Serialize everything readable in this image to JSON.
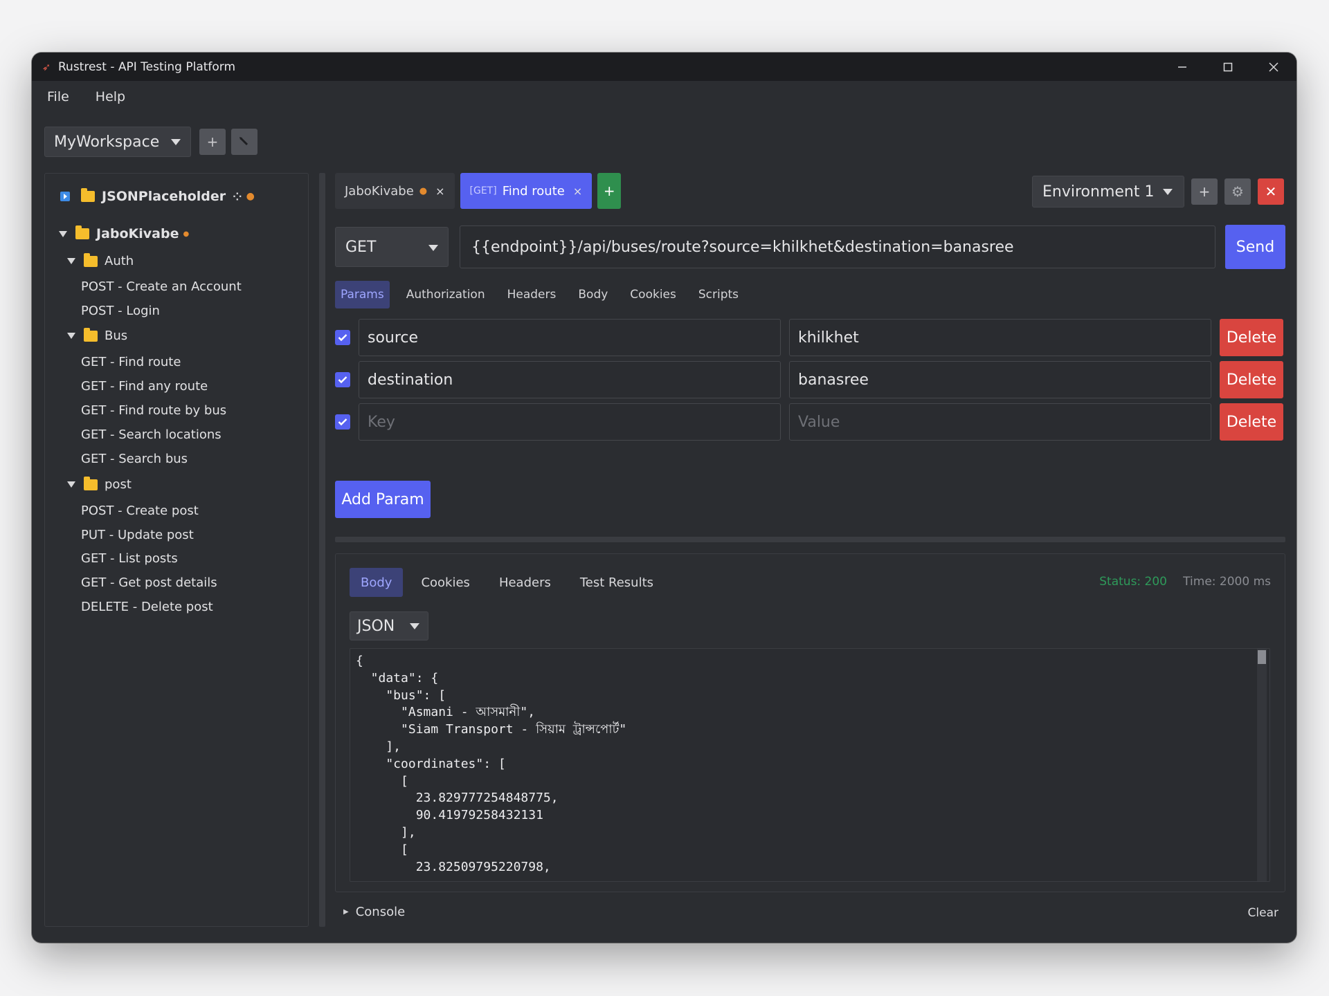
{
  "window": {
    "title": "Rustrest - API Testing Platform"
  },
  "menu": [
    "File",
    "Help"
  ],
  "workspace": {
    "selected": "MyWorkspace",
    "add_label": "+"
  },
  "sidebar": {
    "collection": "JSONPlaceholder",
    "project": "JaboKivabe",
    "folders": [
      {
        "name": "Auth",
        "items": [
          "POST - Create an Account",
          "POST - Login"
        ]
      },
      {
        "name": "Bus",
        "items": [
          "GET - Find route",
          "GET - Find any route",
          "GET - Find route by bus",
          "GET - Search locations",
          "GET - Search bus"
        ]
      },
      {
        "name": "post",
        "items": [
          "POST - Create post",
          "PUT - Update post",
          "GET - List posts",
          "GET - Get post details",
          "DELETE - Delete post"
        ]
      }
    ]
  },
  "tabs": [
    {
      "label": "JaboKivabe",
      "close": "×"
    },
    {
      "method": "[GET]",
      "label": "Find route",
      "close": "×"
    }
  ],
  "add_tab_label": "+",
  "environment": {
    "selected": "Environment 1",
    "add_label": "+",
    "delete_label": "✕"
  },
  "request": {
    "method": "GET",
    "url": "{{endpoint}}/api/buses/route?source=khilkhet&destination=banasree",
    "send_label": "Send"
  },
  "request_tabs": [
    "Params",
    "Authorization",
    "Headers",
    "Body",
    "Cookies",
    "Scripts"
  ],
  "params": [
    {
      "key": "source",
      "value": "khilkhet",
      "enabled": true
    },
    {
      "key": "destination",
      "value": "banasree",
      "enabled": true
    },
    {
      "key": "",
      "value": "",
      "enabled": true
    }
  ],
  "param_placeholders": {
    "key": "Key",
    "value": "Value"
  },
  "delete_label": "Delete",
  "add_param_label": "Add Param",
  "response": {
    "tabs": [
      "Body",
      "Cookies",
      "Headers",
      "Test Results"
    ],
    "status": "Status: 200",
    "time": "Time: 2000 ms",
    "format": "JSON",
    "body": "{\n  \"data\": {\n    \"bus\": [\n      \"Asmani - আসমানী\",\n      \"Siam Transport - সিয়াম ট্রান্সপোর্ট\"\n    ],\n    \"coordinates\": [\n      [\n        23.829777254848775,\n        90.41979258432131\n      ],\n      [\n        23.82509795220798,"
  },
  "console": {
    "label": "Console",
    "clear_label": "Clear"
  },
  "colors": {
    "accent": "#5661f0",
    "danger": "#d9453f",
    "success": "#2e9a5a",
    "folder": "#f5bd2c",
    "unsaved_dot": "#e38a2e"
  }
}
